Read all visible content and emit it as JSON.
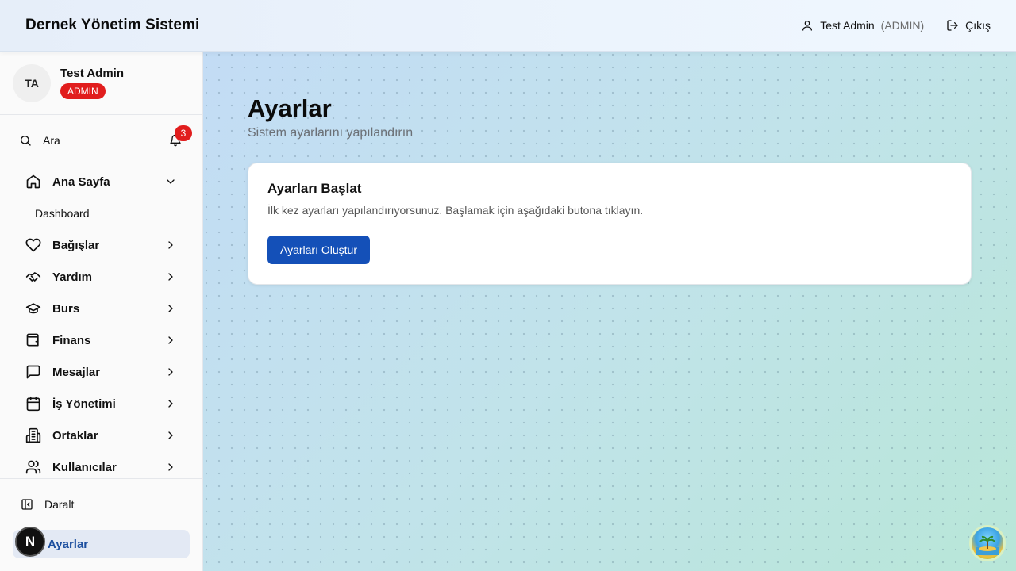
{
  "header": {
    "title": "Dernek Yönetim Sistemi",
    "user_name": "Test Admin",
    "user_role": "(ADMIN)",
    "logout_label": "Çıkış"
  },
  "sidebar": {
    "profile": {
      "initials": "TA",
      "name": "Test Admin",
      "role": "ADMIN"
    },
    "search_label": "Ara",
    "notification_count": "3",
    "items": [
      {
        "label": "Ana Sayfa",
        "icon": "home-icon",
        "expanded": true
      },
      {
        "label": "Bağışlar",
        "icon": "heart-icon"
      },
      {
        "label": "Yardım",
        "icon": "handshake-icon"
      },
      {
        "label": "Burs",
        "icon": "graduation-cap-icon"
      },
      {
        "label": "Finans",
        "icon": "wallet-icon"
      },
      {
        "label": "Mesajlar",
        "icon": "message-icon"
      },
      {
        "label": "İş Yönetimi",
        "icon": "calendar-icon"
      },
      {
        "label": "Ortaklar",
        "icon": "building-icon"
      },
      {
        "label": "Kullanıcılar",
        "icon": "users-icon"
      }
    ],
    "sub_items": {
      "dashboard": "Dashboard"
    },
    "collapse_label": "Daralt",
    "active_label": "Ayarlar"
  },
  "main": {
    "title": "Ayarlar",
    "subtitle": "Sistem ayarlarını yapılandırın",
    "card": {
      "title": "Ayarları Başlat",
      "description": "İlk kez ayarları yapılandırıyorsunuz. Başlamak için aşağıdaki butona tıklayın.",
      "button_label": "Ayarları Oluştur"
    }
  },
  "overlay": {
    "dev_logo": "N"
  },
  "colors": {
    "accent": "#1450b8",
    "badge": "#e11d1d",
    "active_bg": "#e3e9f4",
    "active_text": "#1d4f9f"
  }
}
